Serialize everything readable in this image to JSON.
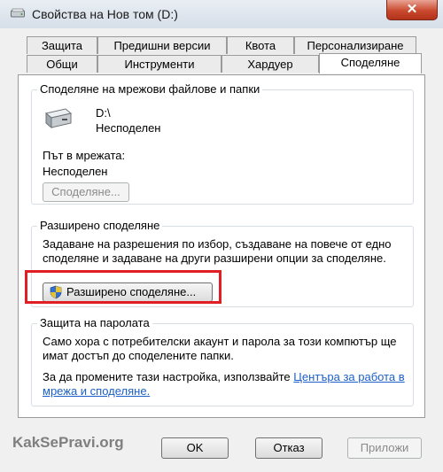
{
  "window": {
    "title": "Свойства на Нов том (D:)",
    "close_label": "✕"
  },
  "tabs_row1": [
    {
      "label": "Защита"
    },
    {
      "label": "Предишни версии"
    },
    {
      "label": "Квота"
    },
    {
      "label": "Персонализиране"
    }
  ],
  "tabs_row2": [
    {
      "label": "Общи"
    },
    {
      "label": "Инструменти"
    },
    {
      "label": "Хардуер"
    },
    {
      "label": "Споделяне"
    }
  ],
  "active_tab": "Споделяне",
  "network_sharing": {
    "legend": "Споделяне на мрежови файлове и папки",
    "drive_path": "D:\\",
    "drive_status": "Несподелен",
    "network_path_label": "Път в мрежата:",
    "network_path_value": "Несподелен",
    "share_button": "Споделяне..."
  },
  "advanced_sharing": {
    "legend": "Разширено споделяне",
    "description": "Задаване на разрешения по избор, създаване на повече от едно споделяне и задаване на други разширени опции за споделяне.",
    "button": "Разширено споделяне..."
  },
  "password_protection": {
    "legend": "Защита на паролата",
    "description": "Само хора с потребителски акаунт и парола за този компютър ще имат достъп до споделените папки.",
    "change_text": "За да промените тази настройка, използвайте",
    "link_text": "Центъра за работа в мрежа и споделяне."
  },
  "footer": {
    "ok": "OK",
    "cancel": "Отказ",
    "apply": "Приложи"
  },
  "watermark": "KakSePravi.org",
  "colors": {
    "highlight": "#e01f24",
    "link": "#1c5fc7"
  }
}
